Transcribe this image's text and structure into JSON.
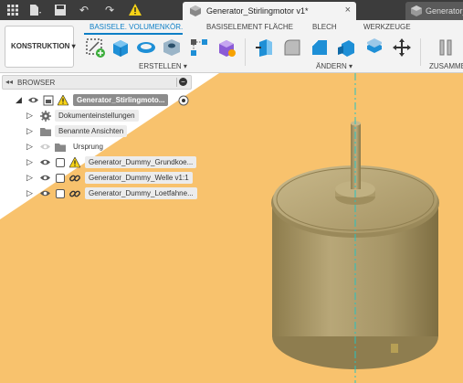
{
  "titlebar": {
    "active_tab": "Generator_Stirlingmotor v1*",
    "inactive_tab": "Generator_",
    "icons": [
      "grid-icon",
      "file-icon",
      "save-icon",
      "undo-icon",
      "redo-icon",
      "warning-icon"
    ]
  },
  "ribbon": {
    "workspace": "KONSTRUKTION ▾",
    "tabs": [
      "BASISELE. VOLUMENKÖR.",
      "BASISELEMENT FLÄCHE",
      "BLECH",
      "WERKZEUGE"
    ],
    "active_tab_index": 0,
    "groups": {
      "create": "ERSTELLEN ▾",
      "modify": "ÄNDERN ▾",
      "assemble": "ZUSAMMEN"
    }
  },
  "browser": {
    "title": "BROWSER",
    "root": "Generator_Stirlingmoto...",
    "items": [
      {
        "label": "Dokumenteinstellungen",
        "icon": "gear-icon"
      },
      {
        "label": "Benannte Ansichten",
        "icon": "folder-icon"
      },
      {
        "label": "Ursprung",
        "icon": "folder-icon"
      },
      {
        "label": "Generator_Dummy_Grundkoe...",
        "icon": "warning-icon"
      },
      {
        "label": "Generator_Dummy_Welle v1:1",
        "icon": "link-icon"
      },
      {
        "label": "Generator_Dummy_Loetfahne...",
        "icon": "link-icon"
      }
    ]
  },
  "colors": {
    "background": "#f8c26d",
    "accent": "#0e7fc6",
    "model": "#a89868"
  }
}
